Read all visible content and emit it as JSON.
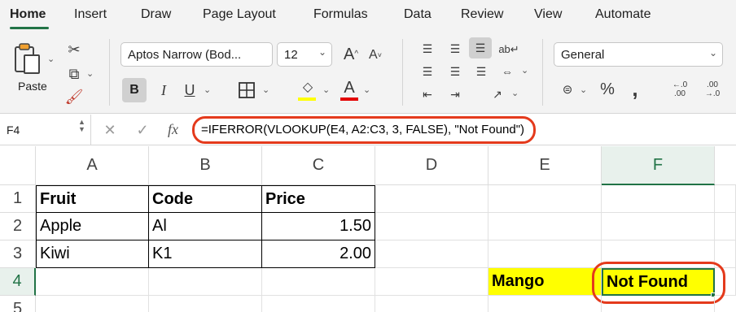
{
  "tabs": [
    "Home",
    "Insert",
    "Draw",
    "Page Layout",
    "Formulas",
    "Data",
    "Review",
    "View",
    "Automate"
  ],
  "clipboard": {
    "paste_label": "Paste"
  },
  "font": {
    "name": "Aptos Narrow (Bod...",
    "size": "12"
  },
  "number_format": "General",
  "formula_bar": {
    "name_box": "F4",
    "fx": "fx",
    "formula": "=IFERROR(VLOOKUP(E4, A2:C3, 3, FALSE), \"Not Found\")"
  },
  "columns": [
    "A",
    "B",
    "C",
    "D",
    "E",
    "F"
  ],
  "rows": [
    "1",
    "2",
    "3",
    "4",
    "5"
  ],
  "cells": {
    "A1": "Fruit",
    "B1": "Code",
    "C1": "Price",
    "A2": "Apple",
    "B2": "Al",
    "C2": "1.50",
    "A3": "Kiwi",
    "B3": "K1",
    "C3": "2.00",
    "E4": "Mango",
    "F4": "Not Found"
  },
  "colors": {
    "accent": "#217346",
    "highlight": "#ffff00",
    "annotation": "#e43a1c",
    "font_color_bar": "#e30000",
    "fill_color_bar": "#ffff00"
  },
  "icons": [
    "paste-icon",
    "cut-icon",
    "copy-icon",
    "format-painter-icon",
    "increase-font-icon",
    "decrease-font-icon",
    "italic-icon",
    "underline-icon",
    "borders-icon",
    "fill-color-icon",
    "font-color-icon",
    "align-top-icon",
    "align-middle-icon",
    "align-bottom-icon",
    "wrap-text-icon",
    "align-left-icon",
    "align-center-icon",
    "align-right-icon",
    "merge-center-icon",
    "orientation-icon",
    "currency-icon",
    "percent-icon",
    "comma-icon",
    "increase-decimal-icon",
    "decrease-decimal-icon"
  ]
}
